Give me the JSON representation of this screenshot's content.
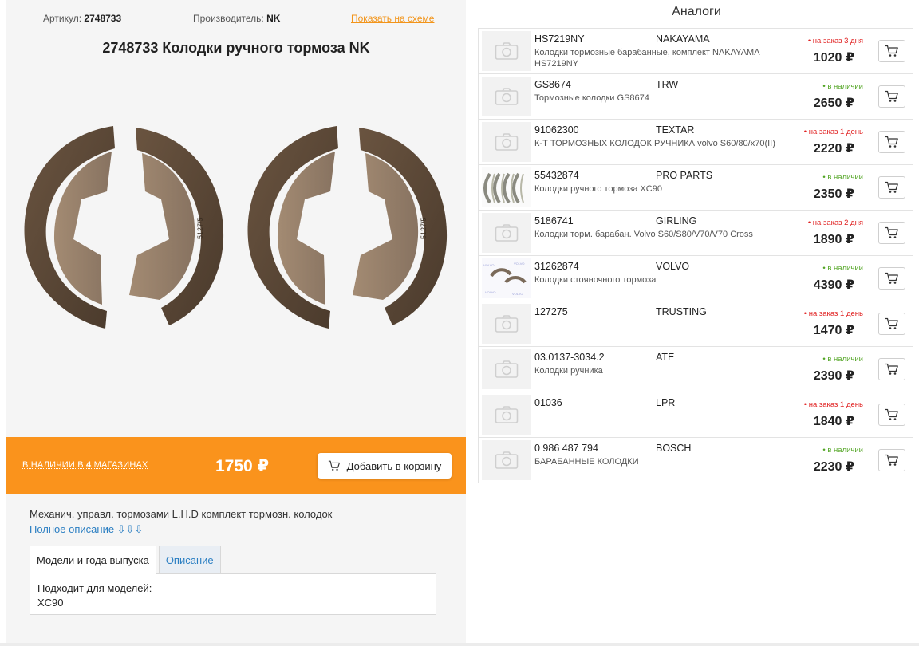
{
  "product": {
    "article_label": "Артикул:",
    "article_value": "2748733",
    "maker_label": "Производитель:",
    "maker_value": "NK",
    "scheme_link": "Показать на схеме",
    "title": "2748733 Колодки ручного тормоза NK",
    "image_stamp_text": "5127/5",
    "stock_prefix": "В НАЛИЧИИ В ",
    "stock_count": "4",
    "stock_suffix": " МАГАЗИНАХ",
    "price": "1750 ₽",
    "add_to_cart": "Добавить в корзину",
    "short_description": "Механич. управл. тормозами L.H.D комплект тормозн. колодок",
    "full_description_link": "Полное описание ⇩⇩⇩"
  },
  "tabs": [
    {
      "label": "Модели и года выпуска"
    },
    {
      "label": "Описание"
    }
  ],
  "tab_content": {
    "line1": "Подходит для моделей:",
    "line2": "XC90"
  },
  "analogs": {
    "title": "Аналоги",
    "items": [
      {
        "part": "HS7219NY",
        "brand": "NAKAYAMA",
        "desc": "Колодки тормозные барабанные, комплект NAKAYAMA HS7219NY",
        "availability": "• на заказ 3 дня",
        "status": "order",
        "price": "1020 ₽",
        "thumb": "camera"
      },
      {
        "part": "GS8674",
        "brand": "TRW",
        "desc": "Тормозные колодки GS8674",
        "availability": "• в наличии",
        "status": "stock",
        "price": "2650 ₽",
        "thumb": "camera"
      },
      {
        "part": "91062300",
        "brand": "TEXTAR",
        "desc": "К-Т ТОРМОЗНЫХ КОЛОДОК РУЧНИКА volvo S60/80/x70(II)",
        "availability": "• на заказ 1 день",
        "status": "order",
        "price": "2220 ₽",
        "thumb": "camera"
      },
      {
        "part": "55432874",
        "brand": "PRO PARTS",
        "desc": "Колодки ручного тормоза XC90",
        "availability": "• в наличии",
        "status": "stock",
        "price": "2350 ₽",
        "thumb": "photo-shoes"
      },
      {
        "part": "5186741",
        "brand": "GIRLING",
        "desc": "Колодки торм. барабан. Volvo S60/S80/V70/V70 Cross",
        "availability": "• на заказ 2 дня",
        "status": "order",
        "price": "1890 ₽",
        "thumb": "camera"
      },
      {
        "part": "31262874",
        "brand": "VOLVO",
        "desc": "Колодки стояночного тормоза",
        "availability": "• в наличии",
        "status": "stock",
        "price": "4390 ₽",
        "thumb": "photo-volvo"
      },
      {
        "part": "127275",
        "brand": "TRUSTING",
        "desc": "",
        "availability": "• на заказ 1 день",
        "status": "order",
        "price": "1470 ₽",
        "thumb": "camera"
      },
      {
        "part": "03.0137-3034.2",
        "brand": "ATE",
        "desc": "Колодки ручника",
        "availability": "• в наличии",
        "status": "stock",
        "price": "2390 ₽",
        "thumb": "camera"
      },
      {
        "part": "01036",
        "brand": "LPR",
        "desc": "",
        "availability": "• на заказ 1 день",
        "status": "order",
        "price": "1840 ₽",
        "thumb": "camera"
      },
      {
        "part": "0 986 487 794",
        "brand": "BOSCH",
        "desc": "БАРАБАННЫЕ КОЛОДКИ",
        "availability": "• в наличии",
        "status": "stock",
        "price": "2230 ₽",
        "thumb": "camera"
      }
    ]
  },
  "colors": {
    "accent_orange": "#fa931c",
    "link_blue": "#2a7ec2",
    "in_stock_green": "#52a524",
    "on_order_red": "#e02020"
  }
}
